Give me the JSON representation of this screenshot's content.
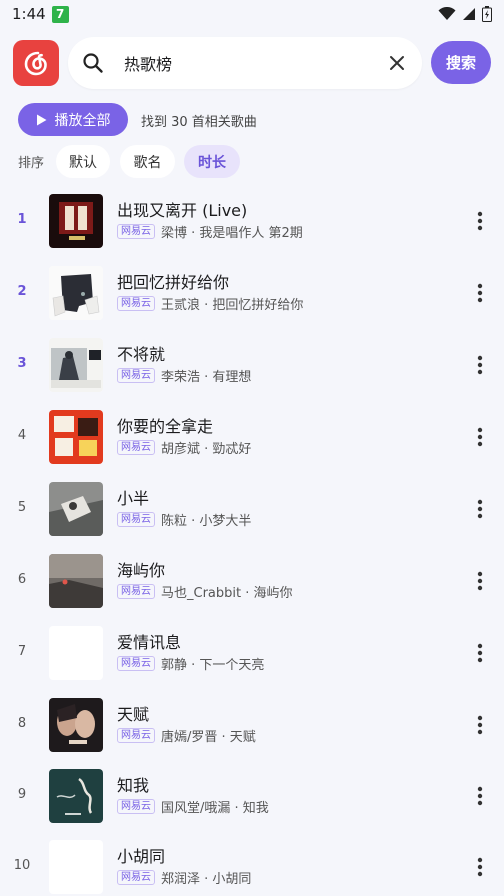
{
  "status_bar": {
    "time": "1:44",
    "badge": "7"
  },
  "search": {
    "value": "热歌榜",
    "button_label": "搜索"
  },
  "toolbar": {
    "play_all_label": "播放全部",
    "result_text": "找到 30 首相关歌曲"
  },
  "sort": {
    "label": "排序",
    "options": [
      {
        "label": "默认",
        "active": false
      },
      {
        "label": "歌名",
        "active": false
      },
      {
        "label": "时长",
        "active": true
      }
    ]
  },
  "colors": {
    "accent": "#7a63e6",
    "logo_red": "#e8423f",
    "background": "#f5f6fb"
  },
  "songs": [
    {
      "index": "1",
      "title": "出现又离开 (Live)",
      "source": "网易云",
      "meta": "梁博 · 我是唱作人 第2期"
    },
    {
      "index": "2",
      "title": "把回忆拼好给你",
      "source": "网易云",
      "meta": "王贰浪 · 把回忆拼好给你"
    },
    {
      "index": "3",
      "title": "不将就",
      "source": "网易云",
      "meta": "李荣浩 · 有理想"
    },
    {
      "index": "4",
      "title": "你要的全拿走",
      "source": "网易云",
      "meta": "胡彦斌 · 勁忒好"
    },
    {
      "index": "5",
      "title": "小半",
      "source": "网易云",
      "meta": "陈粒 · 小梦大半"
    },
    {
      "index": "6",
      "title": "海屿你",
      "source": "网易云",
      "meta": "马也_Crabbit · 海屿你"
    },
    {
      "index": "7",
      "title": "爱情讯息",
      "source": "网易云",
      "meta": "郭静 · 下一个天亮"
    },
    {
      "index": "8",
      "title": "天赋",
      "source": "网易云",
      "meta": "唐嫣/罗晋 · 天赋"
    },
    {
      "index": "9",
      "title": "知我",
      "source": "网易云",
      "meta": "国风堂/哦漏 · 知我"
    },
    {
      "index": "10",
      "title": "小胡同",
      "source": "网易云",
      "meta": "郑润泽 · 小胡同"
    }
  ]
}
